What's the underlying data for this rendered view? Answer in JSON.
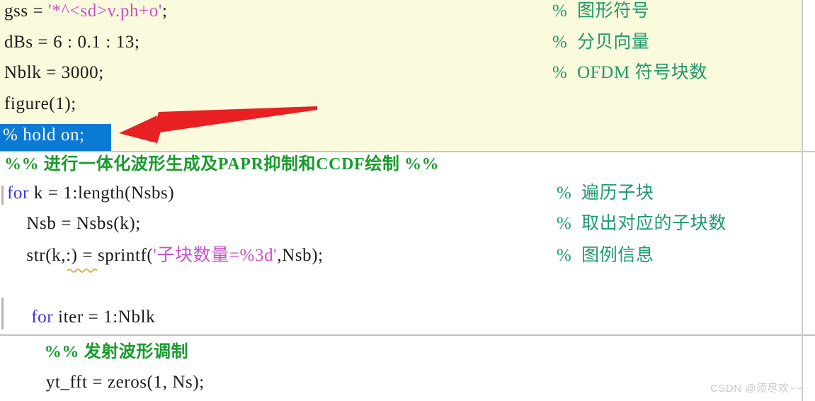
{
  "editor": {
    "app": "MATLAB Editor",
    "background_code_section": "#fafadc",
    "background_plain": "#ffffff",
    "colors": {
      "comment_green": "#1d9a6c",
      "string_magenta": "#c850c8",
      "keyword_blue": "#3a33d6",
      "cell_header_green": "#179b2a",
      "selection_blue": "#0b7ad4",
      "selection_text": "#ffffff",
      "annotation_red": "#e81f23",
      "gutter_gray": "#b4b4b4",
      "rule_gray": "#c8c8c8",
      "watermark_gray": "#c9c9c9"
    },
    "lines": [
      {
        "id": "line-gss",
        "segments": [
          {
            "text": "gss = ",
            "kind": "plain"
          },
          {
            "text": "'*^<sd>v.ph+o'",
            "kind": "string"
          },
          {
            "text": ";",
            "kind": "plain"
          }
        ],
        "comment": "%  图形符号"
      },
      {
        "id": "line-dbs",
        "segments": [
          {
            "text": "dBs = 6 : 0.1 : 13;",
            "kind": "plain"
          }
        ],
        "comment": "%  分贝向量"
      },
      {
        "id": "line-nblk",
        "segments": [
          {
            "text": "Nblk = 3000;",
            "kind": "plain"
          }
        ],
        "comment": "%  OFDM 符号块数"
      },
      {
        "id": "line-figure",
        "segments": [
          {
            "text": "figure(1);",
            "kind": "plain"
          }
        ],
        "comment": ""
      },
      {
        "id": "line-hold-on",
        "selected": true,
        "segments": [
          {
            "text": "% hold on;",
            "kind": "selected"
          }
        ],
        "comment": ""
      },
      {
        "id": "line-cell-header",
        "segments": [
          {
            "text": "%% 进行一体化波形生成及PAPR抑制和CCDF绘制 %%",
            "kind": "cell"
          }
        ],
        "comment": ""
      },
      {
        "id": "line-for-k",
        "segments": [
          {
            "text": "for",
            "kind": "keyword"
          },
          {
            "text": " k = 1:length(Nsbs)",
            "kind": "plain"
          }
        ],
        "comment": "%  遍历子块"
      },
      {
        "id": "line-nsb",
        "segments": [
          {
            "text": "    Nsb = Nsbs(k);",
            "kind": "plain"
          }
        ],
        "comment": "%  取出对应的子块数"
      },
      {
        "id": "line-str",
        "segments": [
          {
            "text": "    str(k,:) = sprintf(",
            "kind": "plain"
          },
          {
            "text": "'子块数量=%3d'",
            "kind": "string"
          },
          {
            "text": ",Nsb);",
            "kind": "plain"
          }
        ],
        "comment": "%  图例信息"
      },
      {
        "id": "line-blank",
        "segments": [],
        "comment": ""
      },
      {
        "id": "line-for-iter",
        "segments": [
          {
            "text": "     ",
            "kind": "plain"
          },
          {
            "text": "for",
            "kind": "keyword"
          },
          {
            "text": " iter = 1:Nblk",
            "kind": "plain"
          }
        ],
        "comment": ""
      },
      {
        "id": "line-cell-header-2",
        "segments": [
          {
            "text": "        %% 发射波形调制",
            "kind": "cell"
          }
        ],
        "comment": ""
      },
      {
        "id": "line-yt-fft",
        "segments": [
          {
            "text": "        yt_fft = zeros(1, Ns);",
            "kind": "plain"
          }
        ],
        "comment": ""
      }
    ]
  },
  "annotation": {
    "type": "arrow",
    "direction": "left",
    "color": "#e81f23",
    "points_at": "% hold on;"
  },
  "watermark": {
    "text": "CSDN @须尽欢~~"
  }
}
